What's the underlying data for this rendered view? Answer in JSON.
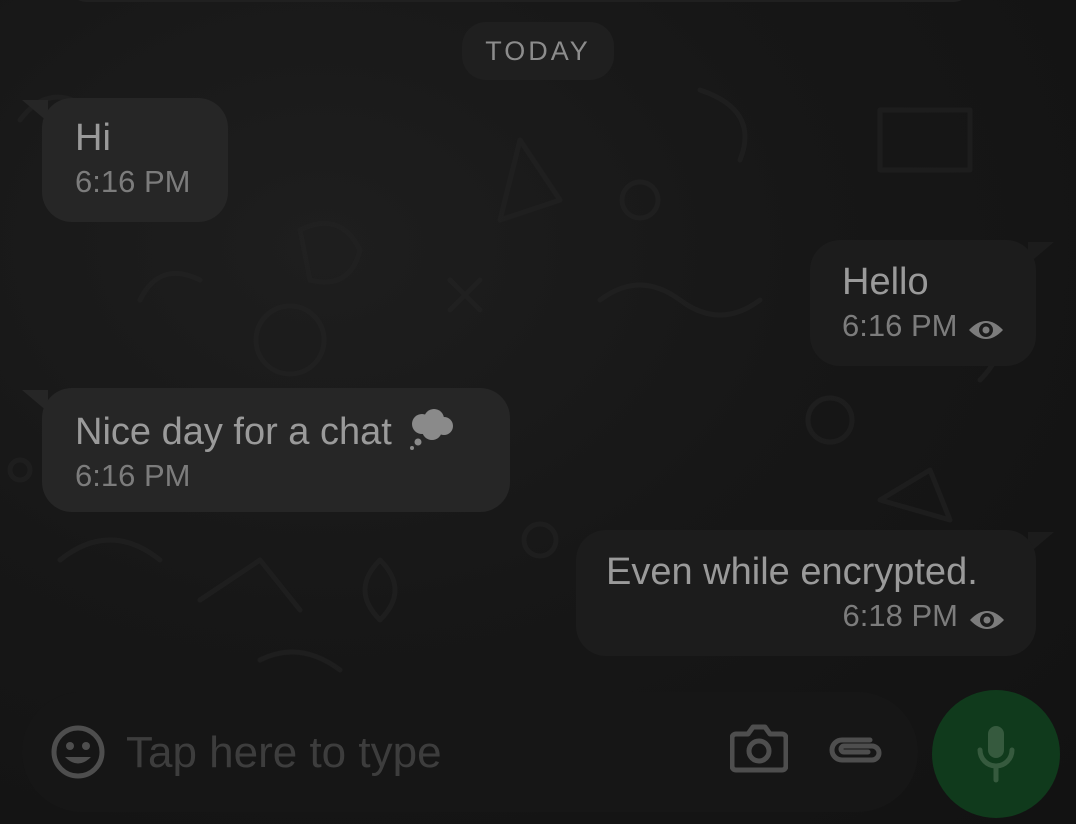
{
  "chat": {
    "date_separator": "TODAY",
    "messages": [
      {
        "direction": "incoming",
        "text": "Hi",
        "time": "6:16 PM"
      },
      {
        "direction": "outgoing",
        "text": "Hello",
        "time": "6:16 PM",
        "status_icon": "eye-icon"
      },
      {
        "direction": "incoming",
        "text": "Nice day for a chat",
        "emoji_icon": "thought-cloud-icon",
        "time": "6:16 PM"
      },
      {
        "direction": "outgoing",
        "text": "Even while encrypted.",
        "time": "6:18 PM",
        "status_icon": "eye-icon"
      }
    ]
  },
  "composer": {
    "placeholder": "Tap here to type",
    "value": "",
    "icons": {
      "emoji": "smiley-icon",
      "camera": "camera-icon",
      "attach": "paperclip-icon",
      "mic": "microphone-icon"
    }
  },
  "colors": {
    "background": "#131313",
    "incoming_bubble": "#262626",
    "outgoing_bubble": "#1c1c1c",
    "mic_button": "#103a1c"
  }
}
